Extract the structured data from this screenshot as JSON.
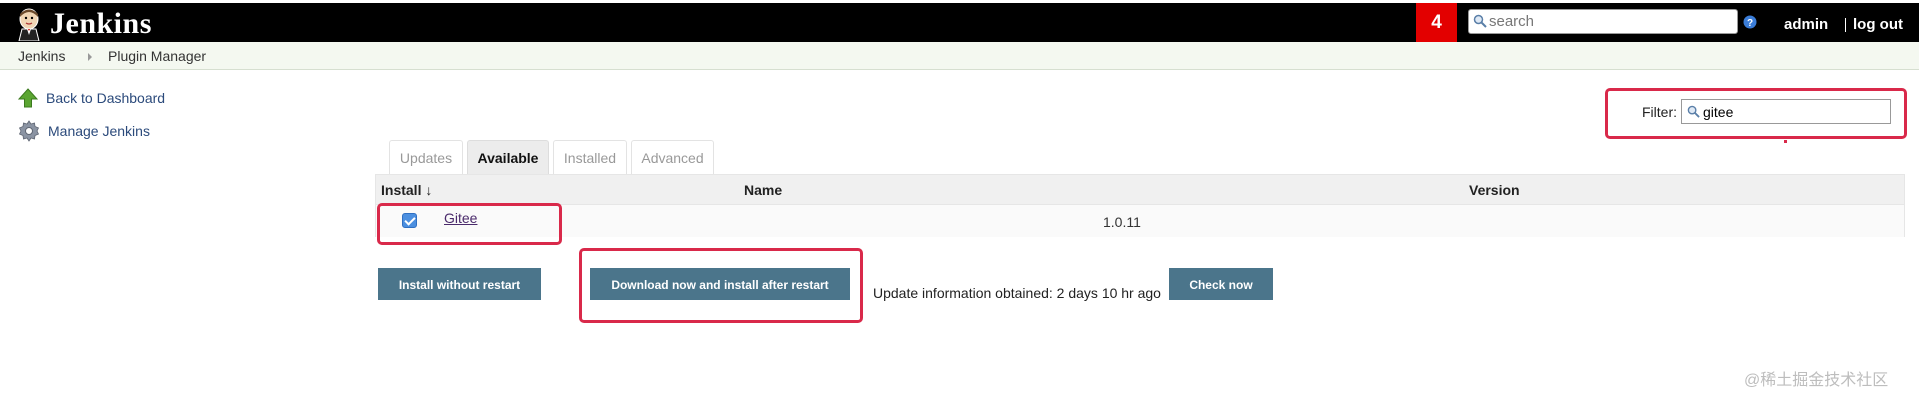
{
  "header": {
    "logo_text": "Jenkins",
    "notification_count": "4",
    "search_placeholder": "search",
    "user": "admin",
    "logout": "log out"
  },
  "breadcrumb": [
    "Jenkins",
    "Plugin Manager"
  ],
  "sidebar": {
    "items": [
      {
        "label": "Back to Dashboard",
        "icon": "up-arrow-icon"
      },
      {
        "label": "Manage Jenkins",
        "icon": "gear-icon"
      }
    ]
  },
  "filter": {
    "label": "Filter:",
    "value": "gitee"
  },
  "tabs": [
    {
      "label": "Updates",
      "active": false
    },
    {
      "label": "Available",
      "active": true
    },
    {
      "label": "Installed",
      "active": false
    },
    {
      "label": "Advanced",
      "active": false
    }
  ],
  "table": {
    "headers": {
      "install": "Install ↓",
      "name": "Name",
      "version": "Version"
    },
    "rows": [
      {
        "checked": true,
        "name": "Gitee",
        "version": "1.0.11"
      }
    ]
  },
  "buttons": {
    "install_without_restart": "Install without restart",
    "download_and_install": "Download now and install after restart",
    "check_now": "Check now"
  },
  "update_info": "Update information obtained: 2 days 10 hr ago",
  "watermark": "@稀土掘金技术社区",
  "colors": {
    "header_bg": "#000000",
    "notification_bg": "#e30000",
    "button_bg": "#4b758b",
    "annotation": "#d9294a",
    "breadcrumb_bg": "#f4f8f0"
  }
}
